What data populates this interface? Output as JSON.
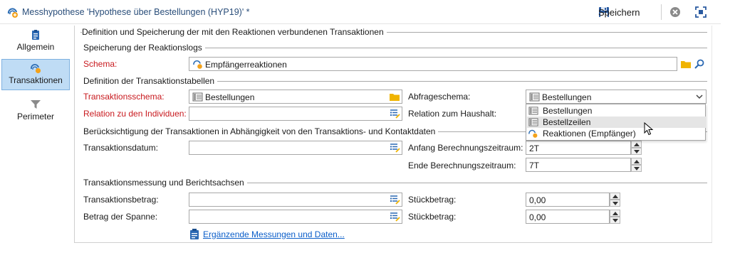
{
  "window": {
    "title": "Messhypothese 'Hypothese über Bestellungen (HYP19)' *",
    "save_label": "Speichern"
  },
  "nav": {
    "items": [
      {
        "label": "Allgemein",
        "icon": "clipboard-icon",
        "active": false
      },
      {
        "label": "Transaktionen",
        "icon": "hypothesis-icon",
        "active": true
      },
      {
        "label": "Perimeter",
        "icon": "filter-icon",
        "active": false
      }
    ]
  },
  "sections": {
    "main": "Definition und Speicherung der mit den Reaktionen verbundenen Transaktionen",
    "log_storage": "Speicherung der Reaktionslogs",
    "transaction_tables": "Definition der Transaktionstabellen",
    "dependency": "Berücksichtigung der Transaktionen in Abhängigkeit von den Transaktions- und Kontaktdaten",
    "measurement": "Transaktionsmessung und Berichtsachsen"
  },
  "fields": {
    "schema": {
      "label": "Schema:",
      "value": "Empfängerreaktionen"
    },
    "transaction_schema": {
      "label": "Transaktionsschema:",
      "value": "Bestellungen"
    },
    "query_schema": {
      "label": "Abfrageschema:",
      "value": "Bestellungen"
    },
    "relation_individuals": {
      "label": "Relation zu den Individuen:",
      "value": ""
    },
    "relation_household": {
      "label": "Relation zum Haushalt:",
      "value": ""
    },
    "transaction_date": {
      "label": "Transaktionsdatum:",
      "value": ""
    },
    "period_start": {
      "label": "Anfang Berechnungszeitraum:",
      "value": "2T"
    },
    "period_end": {
      "label": "Ende Berechnungszeitraum:",
      "value": "7T"
    },
    "transaction_amount": {
      "label": "Transaktionsbetrag:",
      "value": ""
    },
    "unit_amount_1": {
      "label": "Stückbetrag:",
      "value": "0,00"
    },
    "margin_amount": {
      "label": "Betrag der Spanne:",
      "value": ""
    },
    "unit_amount_2": {
      "label": "Stückbetrag:",
      "value": "0,00"
    }
  },
  "dropdown": {
    "options": [
      {
        "label": "Bestellungen",
        "icon": "table-icon",
        "highlighted": false
      },
      {
        "label": "Bestellzeilen",
        "icon": "table-icon",
        "highlighted": true
      },
      {
        "label": "Reaktionen (Empfänger)",
        "icon": "hypothesis-icon",
        "highlighted": false
      }
    ]
  },
  "link": {
    "label": "Ergänzende Messungen und Daten..."
  },
  "colors": {
    "required": "#c8191e",
    "accent": "#2a4e7a",
    "link": "#0b5ec9",
    "nav_active": "#bfdcf5",
    "folder": "#f0b400"
  }
}
